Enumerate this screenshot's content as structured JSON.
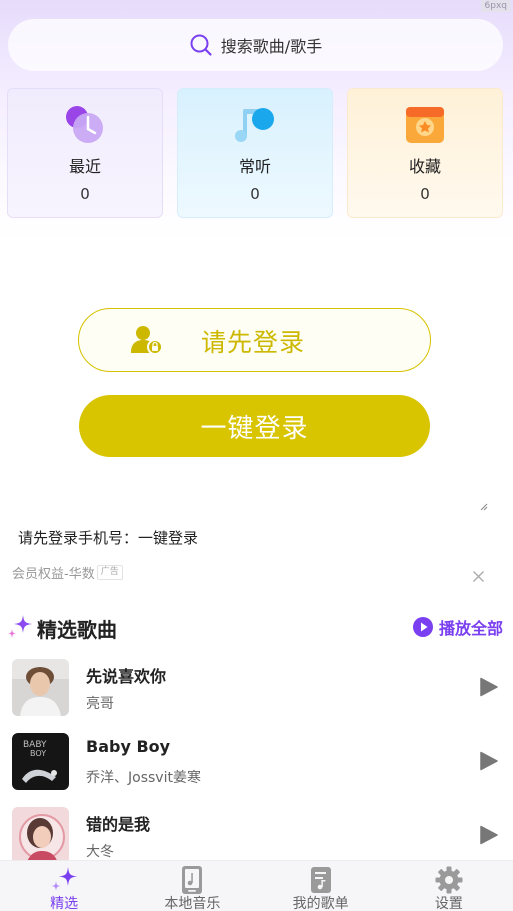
{
  "corner_tag": "6pxq",
  "search": {
    "placeholder": "搜索歌曲/歌手"
  },
  "cards": [
    {
      "name": "最近",
      "count": "0"
    },
    {
      "name": "常听",
      "count": "0"
    },
    {
      "name": "收藏",
      "count": "0"
    }
  ],
  "login": {
    "prompt_label": "请先登录",
    "one_click_label": "一键登录",
    "hint": "请先登录手机号：一键登录"
  },
  "ad": {
    "text": "会员权益-华数",
    "tag": "广告"
  },
  "featured": {
    "title": "精选歌曲",
    "play_all": "播放全部",
    "songs": [
      {
        "title": "先说喜欢你",
        "artist": "亮哥"
      },
      {
        "title": "Baby Boy",
        "artist": "乔洋、Jossvit姜寒"
      },
      {
        "title": "错的是我",
        "artist": "大冬"
      }
    ]
  },
  "tabs": [
    {
      "label": "精选",
      "active": true
    },
    {
      "label": "本地音乐"
    },
    {
      "label": "我的歌单"
    },
    {
      "label": "设置"
    }
  ],
  "colors": {
    "accent": "#7a3ff0",
    "login_yellow": "#d9c400"
  }
}
